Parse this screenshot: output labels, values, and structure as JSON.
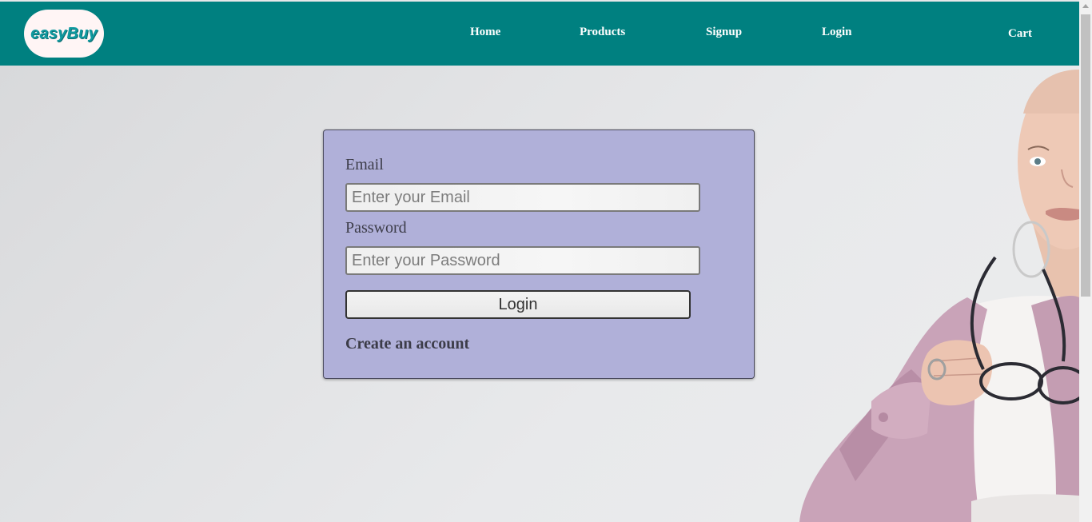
{
  "brand": {
    "logo_text": "easyBuy"
  },
  "nav": {
    "home": "Home",
    "products": "Products",
    "signup": "Signup",
    "login": "Login",
    "cart": "Cart"
  },
  "login_form": {
    "email_label": "Email",
    "email_placeholder": "Enter your Email",
    "email_value": "",
    "password_label": "Password",
    "password_placeholder": "Enter your Password",
    "password_value": "",
    "submit_label": "Login",
    "create_account_link": "Create an account"
  },
  "colors": {
    "navbar": "#008080",
    "card_background": "#b0b0d9",
    "logo_background": "#fff5f5",
    "logo_text": "#0f9aa0"
  }
}
